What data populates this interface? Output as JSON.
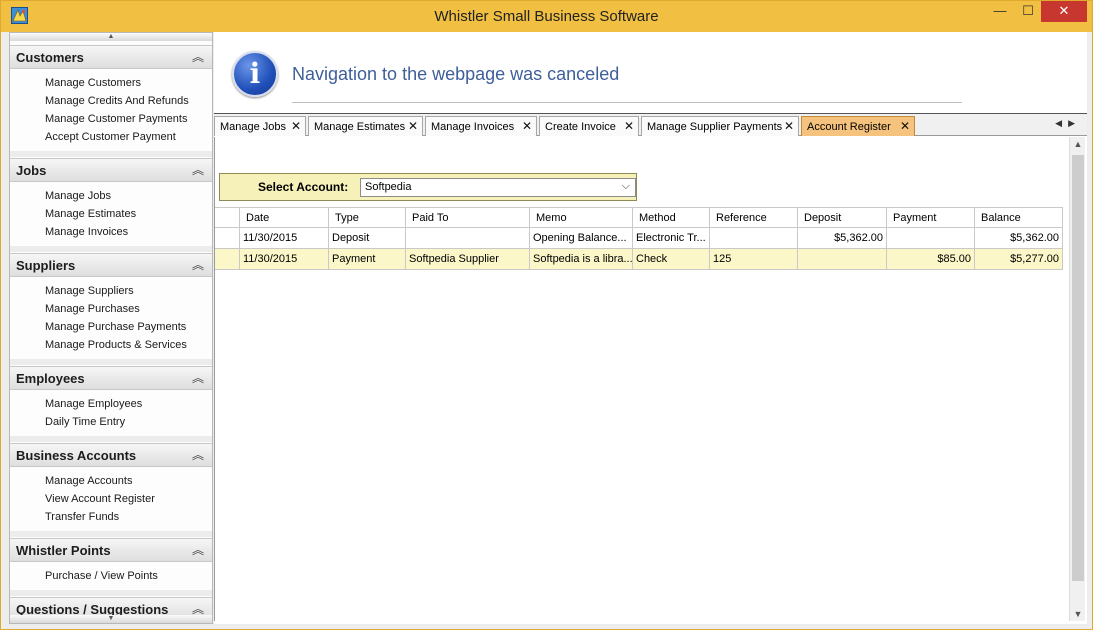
{
  "window": {
    "title": "Whistler Small  Business Software",
    "minimize": "—",
    "maximize": "☐",
    "close": "✕"
  },
  "sidebar": {
    "groups": [
      {
        "title": "Customers",
        "items": [
          "Manage Customers",
          "Manage Credits And Refunds",
          "Manage Customer Payments",
          "Accept Customer Payment"
        ]
      },
      {
        "title": "Jobs",
        "items": [
          "Manage Jobs",
          "Manage Estimates",
          "Manage Invoices"
        ]
      },
      {
        "title": "Suppliers",
        "items": [
          "Manage Suppliers",
          "Manage Purchases",
          "Manage Purchase Payments",
          "Manage Products & Services"
        ]
      },
      {
        "title": "Employees",
        "items": [
          "Manage Employees",
          "Daily Time Entry"
        ]
      },
      {
        "title": "Business Accounts",
        "items": [
          "Manage Accounts",
          "View Account Register",
          "Transfer Funds"
        ]
      },
      {
        "title": "Whistler Points",
        "items": [
          "Purchase / View Points"
        ]
      },
      {
        "title": "Questions / Suggestions",
        "items": []
      }
    ]
  },
  "info": {
    "message": "Navigation to the webpage was canceled"
  },
  "tabs": [
    {
      "label": "Manage Jobs",
      "active": false
    },
    {
      "label": "Manage Estimates",
      "active": false
    },
    {
      "label": "Manage Invoices",
      "active": false
    },
    {
      "label": "Create Invoice",
      "active": false
    },
    {
      "label": "Manage Supplier Payments",
      "active": false
    },
    {
      "label": "Account Register",
      "active": true
    }
  ],
  "register": {
    "select_label": "Select Account:",
    "selected_account": "Softpedia",
    "columns": [
      "",
      "Date",
      "Type",
      "Paid To",
      "Memo",
      "Method",
      "Reference",
      "Deposit",
      "Payment",
      "Balance"
    ],
    "rows": [
      {
        "date": "11/30/2015",
        "type": "Deposit",
        "paid_to": "",
        "memo": "Opening Balance...",
        "method": "Electronic Tr...",
        "reference": "",
        "deposit": "$5,362.00",
        "payment": "",
        "balance": "$5,362.00"
      },
      {
        "date": "11/30/2015",
        "type": "Payment",
        "paid_to": "Softpedia Supplier",
        "memo": "Softpedia is a libra...",
        "method": "Check",
        "reference": "125",
        "deposit": "",
        "payment": "$85.00",
        "balance": "$5,277.00"
      }
    ]
  },
  "colors": {
    "titlebar": "#f1c043",
    "active_tab": "#f6c37e",
    "account_box": "#f6f0b9",
    "info_text": "#3e5f9a",
    "close_button": "#c7372f"
  }
}
